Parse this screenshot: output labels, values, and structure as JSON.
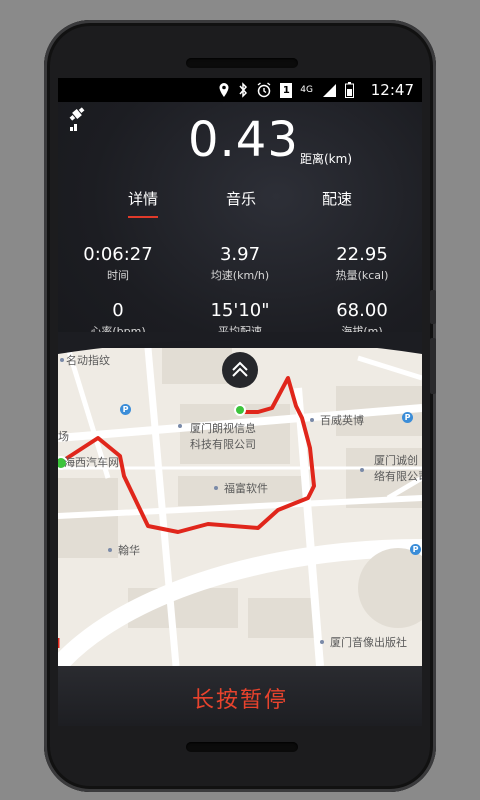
{
  "status_bar": {
    "time": "12:47",
    "network": "4G",
    "sim_badge": "1",
    "icons": [
      "location-icon",
      "bluetooth-icon",
      "alarm-icon",
      "sim-icon",
      "signal-icon",
      "battery-icon"
    ]
  },
  "header": {
    "distance_value": "0.43",
    "distance_unit": "距离(km)"
  },
  "tabs": [
    {
      "label": "详情",
      "active": true
    },
    {
      "label": "音乐",
      "active": false
    },
    {
      "label": "配速",
      "active": false
    }
  ],
  "stats": [
    {
      "value": "0:06:27",
      "label": "时间"
    },
    {
      "value": "3.97",
      "label": "均速(km/h)"
    },
    {
      "value": "22.95",
      "label": "热量(kcal)"
    },
    {
      "value": "0",
      "label": "心率(bpm)"
    },
    {
      "value": "15'10\"",
      "label": "平均配速"
    },
    {
      "value": "68.00",
      "label": "海拔(m)"
    }
  ],
  "map": {
    "labels": [
      "名动指纹",
      "厦门朗视信息\n科技有限公司",
      "百威英博",
      "厦门诚创\n络有限公司",
      "福富软件",
      "海西汽车网",
      "翰华",
      "厦门音像出版社",
      "场"
    ],
    "route_color": "#e0261b",
    "start_color": "#3cc43c"
  },
  "bottom": {
    "pause_label": "长按暂停"
  },
  "colors": {
    "accent": "#e8432d",
    "dark_bg": "#1f2025"
  }
}
